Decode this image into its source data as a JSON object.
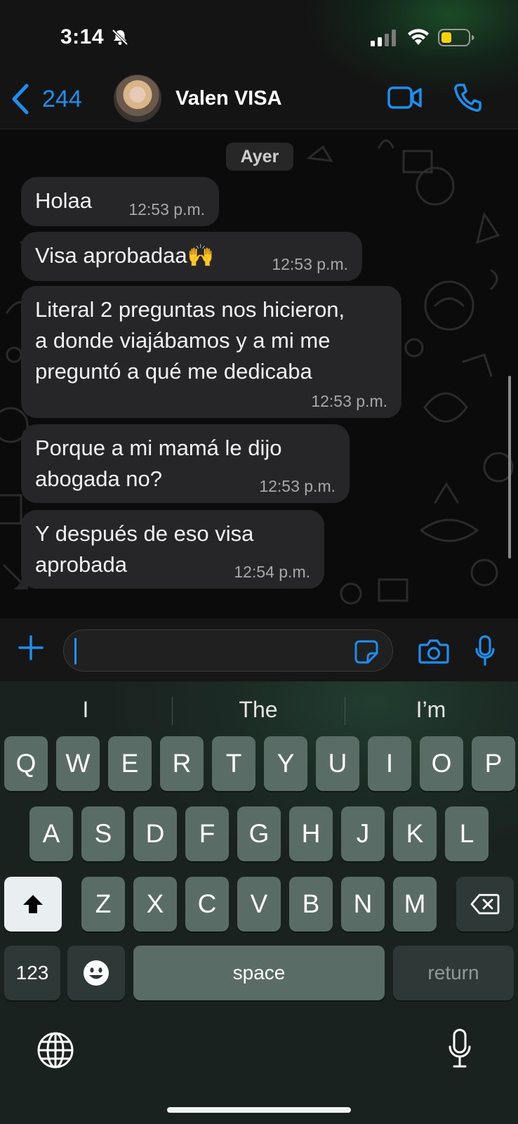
{
  "status_bar": {
    "time": "3:14"
  },
  "header": {
    "back_count": "244",
    "contact_name": "Valen VISA"
  },
  "chat": {
    "date_label": "Ayer",
    "messages": [
      {
        "text": "Holaa",
        "time": "12:53 p.m."
      },
      {
        "text": "Visa aprobadaa🙌",
        "time": "12:53 p.m."
      },
      {
        "lines": [
          "Literal 2 preguntas nos hicieron,",
          "a donde viajábamos y a mi me",
          "preguntó a qué me dedicaba"
        ],
        "time": "12:53 p.m."
      },
      {
        "lines": [
          "Porque a mi mamá le dijo",
          "abogada no?"
        ],
        "time": "12:53 p.m."
      },
      {
        "lines": [
          "Y después de eso visa",
          "aprobada"
        ],
        "time": "12:54 p.m."
      }
    ]
  },
  "input": {
    "value": "",
    "placeholder": ""
  },
  "keyboard": {
    "suggestions": [
      "I",
      "The",
      "I’m"
    ],
    "row1": [
      "Q",
      "W",
      "E",
      "R",
      "T",
      "Y",
      "U",
      "I",
      "O",
      "P"
    ],
    "row2": [
      "A",
      "S",
      "D",
      "F",
      "G",
      "H",
      "J",
      "K",
      "L"
    ],
    "row3": [
      "Z",
      "X",
      "C",
      "V",
      "B",
      "N",
      "M"
    ],
    "numbers_label": "123",
    "space_label": "space",
    "return_label": "return"
  },
  "colors": {
    "accent": "#1d8ff0",
    "bubble": "#262628",
    "key": "#5a6c66"
  },
  "icons": [
    "bell-slash-icon",
    "signal-icon",
    "wifi-icon",
    "battery-icon",
    "back-chevron-icon",
    "video-call-icon",
    "phone-icon",
    "plus-icon",
    "sticker-icon",
    "camera-icon",
    "microphone-icon",
    "shift-icon",
    "delete-icon",
    "emoji-icon",
    "globe-icon"
  ]
}
